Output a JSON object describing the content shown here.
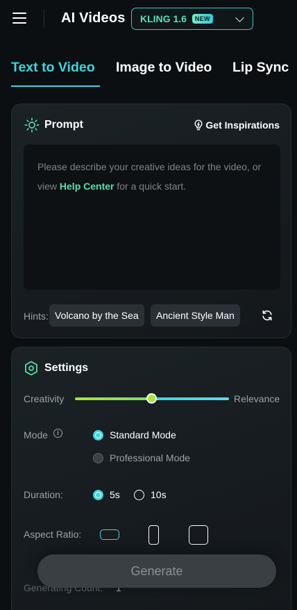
{
  "header": {
    "title": "AI Videos",
    "model": {
      "name": "KLING 1.6",
      "badge": "NEW"
    }
  },
  "tabs": [
    {
      "label": "Text to Video",
      "active": true
    },
    {
      "label": "Image to Video",
      "active": false
    },
    {
      "label": "Lip Sync",
      "active": false
    }
  ],
  "prompt": {
    "title": "Prompt",
    "inspirations_label": "Get Inspirations",
    "placeholder_before": "Please describe your creative ideas for the video, or view ",
    "placeholder_link": "Help Center",
    "placeholder_after": " for a quick start.",
    "hints_label": "Hints:",
    "hints": [
      "Volcano by the Sea",
      "Ancient Style Man"
    ]
  },
  "settings": {
    "title": "Settings",
    "creativity_label": "Creativity",
    "relevance_label": "Relevance",
    "slider_value": 0.5,
    "mode_label": "Mode",
    "modes": [
      {
        "label": "Standard Mode",
        "selected": true
      },
      {
        "label": "Professional Mode",
        "selected": false
      }
    ],
    "duration_label": "Duration:",
    "durations": [
      {
        "label": "5s",
        "selected": true
      },
      {
        "label": "10s",
        "selected": false
      }
    ],
    "aspect_label": "Aspect Ratio:",
    "aspect_options": [
      "wide",
      "tall",
      "square"
    ],
    "count_label": "Generating Count:",
    "count_value": "1"
  },
  "generate_label": "Generate",
  "colors": {
    "accent": "#3ed6dc",
    "accent_green": "#56e0a6",
    "background": "#0c0f12"
  }
}
